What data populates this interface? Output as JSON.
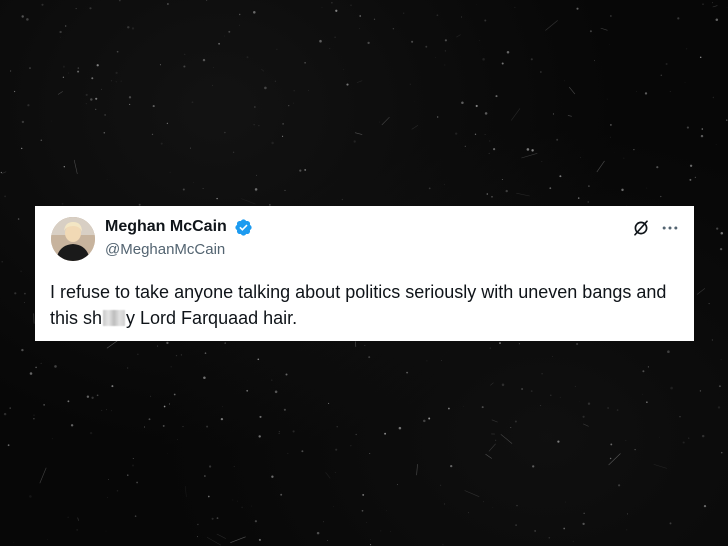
{
  "tweet": {
    "author_name": "Meghan McCain",
    "author_handle": "@MeghanMcCain",
    "verified": true,
    "text_part1": "I refuse to take anyone talking about politics seriously with uneven bangs and this sh",
    "text_part2": "y Lord Farquaad hair.",
    "icons": {
      "avatar": "avatar-photo",
      "verified": "verified-badge-icon",
      "grok": "grok-icon",
      "more": "more-options-icon"
    }
  },
  "colors": {
    "background": "#070707",
    "card": "#ffffff",
    "text": "#0f1419",
    "handle": "#536471",
    "verified": "#1d9bf0"
  }
}
